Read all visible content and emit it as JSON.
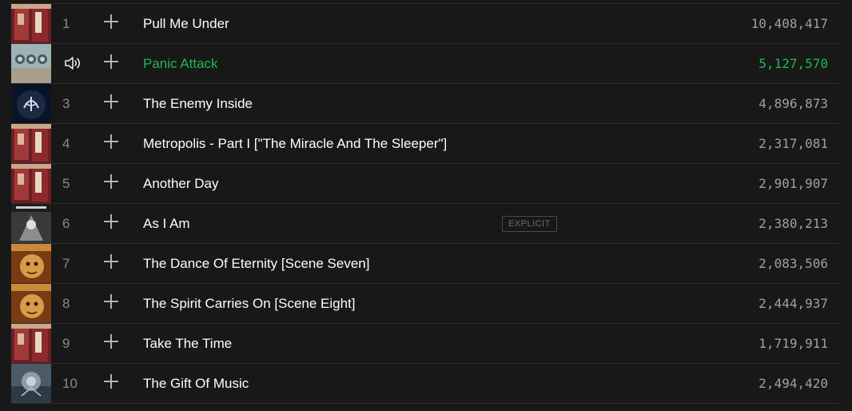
{
  "accent_color": "#1db954",
  "tracks": [
    {
      "number": "1",
      "title": "Pull Me Under",
      "plays": "10,408,417",
      "playing": false,
      "explicit": false,
      "cover": "images-and-words-cover"
    },
    {
      "number": "2",
      "title": "Panic Attack",
      "plays": "5,127,570",
      "playing": true,
      "explicit": false,
      "cover": "octavarium-cover"
    },
    {
      "number": "3",
      "title": "The Enemy Inside",
      "plays": "4,896,873",
      "playing": false,
      "explicit": false,
      "cover": "dream-theater-cover"
    },
    {
      "number": "4",
      "title": "Metropolis - Part I [\"The Miracle And The Sleeper\"]",
      "plays": "2,317,081",
      "playing": false,
      "explicit": false,
      "cover": "images-and-words-cover"
    },
    {
      "number": "5",
      "title": "Another Day",
      "plays": "2,901,907",
      "playing": false,
      "explicit": false,
      "cover": "images-and-words-cover"
    },
    {
      "number": "6",
      "title": "As I Am",
      "plays": "2,380,213",
      "playing": false,
      "explicit": true,
      "explicit_label": "EXPLICIT",
      "cover": "train-of-thought-cover"
    },
    {
      "number": "7",
      "title": "The Dance Of Eternity [Scene Seven]",
      "plays": "2,083,506",
      "playing": false,
      "explicit": false,
      "cover": "scenes-from-a-memory-cover"
    },
    {
      "number": "8",
      "title": "The Spirit Carries On [Scene Eight]",
      "plays": "2,444,937",
      "playing": false,
      "explicit": false,
      "cover": "scenes-from-a-memory-cover"
    },
    {
      "number": "9",
      "title": "Take The Time",
      "plays": "1,719,911",
      "playing": false,
      "explicit": false,
      "cover": "images-and-words-cover"
    },
    {
      "number": "10",
      "title": "The Gift Of Music",
      "plays": "2,494,420",
      "playing": false,
      "explicit": false,
      "cover": "astonishing-cover"
    }
  ]
}
